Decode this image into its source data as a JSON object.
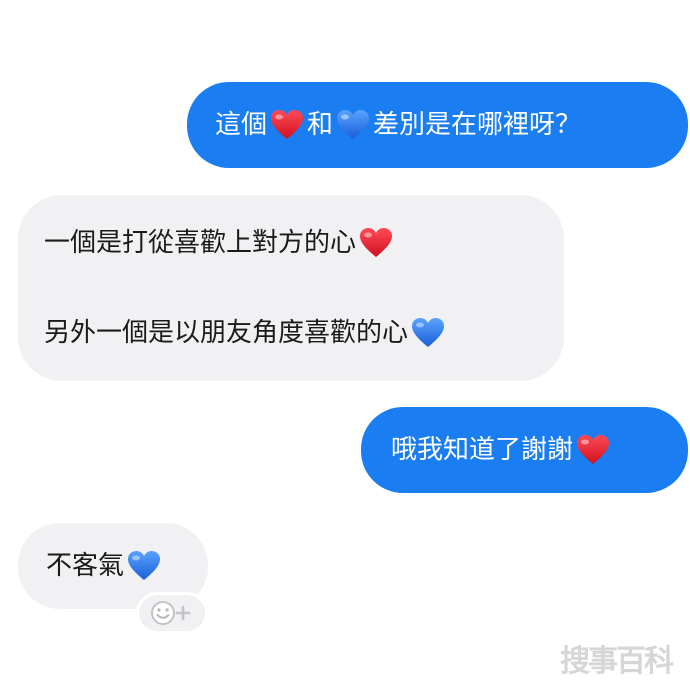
{
  "conversation": {
    "messages": [
      {
        "direction": "outgoing",
        "segments": [
          "這個",
          "heart-red",
          " 和",
          "heart-blue",
          "差別是在哪裡呀？"
        ]
      },
      {
        "direction": "incoming",
        "line1": "一個是打從喜歡上對方的心",
        "line1_emoji": "heart-red",
        "line2": "另外一個是以朋友角度喜歡的心",
        "line2_emoji": "heart-blue"
      },
      {
        "direction": "outgoing",
        "text": "哦我知道了謝謝",
        "emoji": "heart-red"
      },
      {
        "direction": "incoming",
        "text": "不客氣",
        "emoji": "heart-blue"
      }
    ]
  },
  "texts": {
    "m1_part1": "這個",
    "m1_part2": "和",
    "m1_part3": "差別是在哪裡呀？",
    "m2_line1": "一個是打從喜歡上對方的心",
    "m2_line2": "另外一個是以朋友角度喜歡的心",
    "m3_text": "哦我知道了謝謝",
    "m4_text": "不客氣"
  },
  "reaction_button": {
    "icon": "smiley-plus-icon",
    "label": "+"
  },
  "watermark": "搜事百科",
  "colors": {
    "outgoing_bubble": "#1a7ef2",
    "incoming_bubble": "#f1f1f3",
    "red_heart": "#e8202e",
    "blue_heart": "#2f7ff0"
  }
}
